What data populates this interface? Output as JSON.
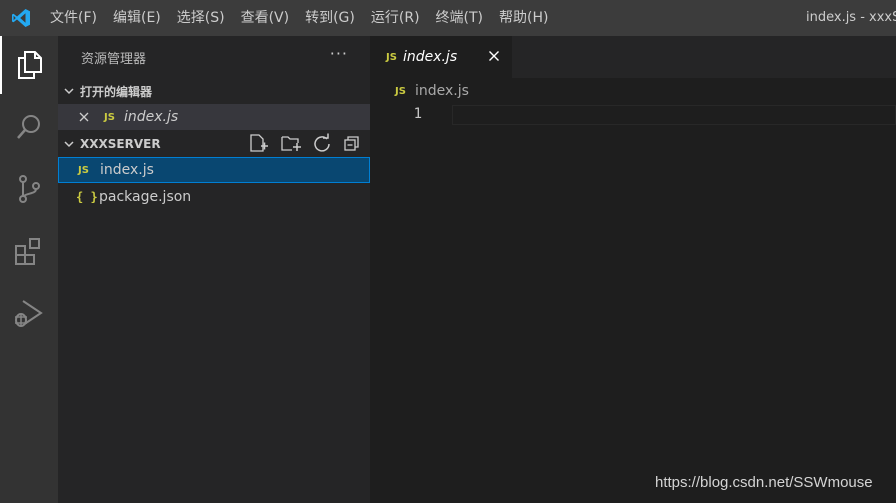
{
  "window": {
    "title": "index.js - xxxSe"
  },
  "menu": {
    "items": [
      "文件(F)",
      "编辑(E)",
      "选择(S)",
      "查看(V)",
      "转到(G)",
      "运行(R)",
      "终端(T)",
      "帮助(H)"
    ]
  },
  "activity_bar": {
    "items": [
      "explorer-icon",
      "search-icon",
      "source-control-icon",
      "extensions-icon",
      "run-debug-icon"
    ]
  },
  "sidebar": {
    "title": "资源管理器",
    "more": "···",
    "open_editors": {
      "label": "打开的编辑器",
      "items": [
        {
          "badge": "JS",
          "name": "index.js"
        }
      ]
    },
    "folder": {
      "label": "XXXSERVER",
      "files": [
        {
          "badge": "JS",
          "name": "index.js"
        },
        {
          "badge": "{ }",
          "name": "package.json"
        }
      ]
    }
  },
  "editor": {
    "tab": {
      "badge": "JS",
      "label": "index.js"
    },
    "breadcrumb": {
      "badge": "JS",
      "label": "index.js"
    },
    "line_number": "1"
  },
  "watermark": "https://blog.csdn.net/SSWmouse",
  "colors": {
    "accent": "#007fd4",
    "selection": "#094771",
    "js_badge": "#cbcb41",
    "vscode_blue": "#23a9f2"
  }
}
